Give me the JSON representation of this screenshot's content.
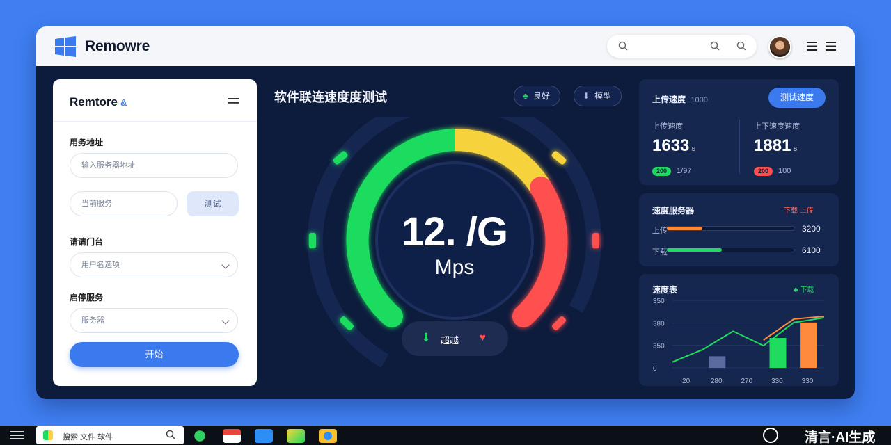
{
  "window": {
    "brand": "Remowre"
  },
  "sidebar": {
    "title": "Remtore",
    "title_accent": "&",
    "fields": [
      {
        "label": "用务地址",
        "placeholder": "输入服务器地址"
      },
      {
        "placeholder": "当前服务"
      },
      {
        "label": "请请门台",
        "placeholder": "用户名选项"
      },
      {
        "label": "启停服务",
        "placeholder": "服务器"
      }
    ],
    "side_button": "测试",
    "start_button": "开始"
  },
  "gauge": {
    "title": "软件联连速度度测试",
    "chip_good": "良好",
    "chip_mode": "模型",
    "value": "12. /G",
    "unit": "Mps",
    "status_label": "超越"
  },
  "upload_card": {
    "title": "上传速度",
    "subtitle": "1000",
    "button": "测试速度",
    "col1_label": "上传速度",
    "col1_value": "1633",
    "col1_unit": "s",
    "col1_badge": "200",
    "col1_note": "1/97",
    "col2_label": "上下速度速度",
    "col2_value": "1881",
    "col2_unit": "s",
    "col2_badge": "200",
    "col2_note": "100"
  },
  "progress_card": {
    "title": "速度服务器",
    "status": "下载 上传",
    "rows": [
      {
        "label": "上传",
        "value": "3200",
        "fraction": 0.28
      },
      {
        "label": "下载",
        "value": "6100",
        "fraction": 0.43
      }
    ]
  },
  "chart_card": {
    "title": "速度表",
    "legend": "下载"
  },
  "chart_data": {
    "type": "bar",
    "categories": [
      "20",
      "280",
      "270",
      "330",
      "330"
    ],
    "yticks": [
      "350",
      "380",
      "350",
      "0"
    ],
    "values": [
      0,
      60,
      0,
      155,
      235
    ],
    "line": [
      30,
      95,
      190,
      115,
      235,
      260
    ],
    "ylim": [
      0,
      350
    ],
    "colors": [
      "#5b6aa0",
      "#5b6aa0",
      "#1fdc5e",
      "#1fdc5e",
      "#ff8a3c"
    ]
  },
  "taskbar": {
    "search_text": "搜索 文件 软件"
  },
  "watermark": "清言·AI生成",
  "colors": {
    "accent": "#3a79ee",
    "green": "#1fdc5e",
    "yellow": "#f6d33c",
    "red": "#ff4f4f",
    "orange": "#ff8a3c",
    "dark": "#0d1b3d"
  }
}
